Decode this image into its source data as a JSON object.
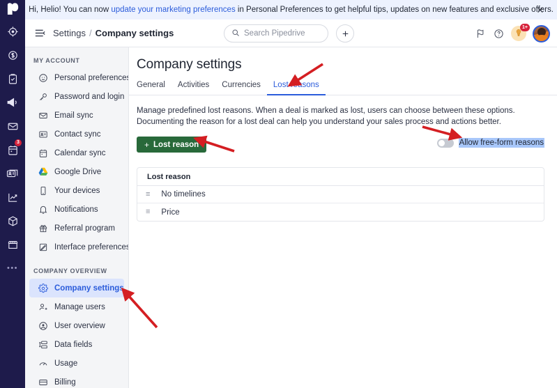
{
  "banner": {
    "text_before": "Hi, Helio! You can now ",
    "link": "update your marketing preferences",
    "text_after": " in Personal Preferences to get helpful tips, updates on new features and exclusive offers.",
    "close_label": "✕"
  },
  "header": {
    "menu_icon": "hamburger-collapse-icon",
    "breadcrumb_root": "Settings",
    "breadcrumb_sep": "/",
    "breadcrumb_current": "Company settings",
    "search_placeholder": "Search Pipedrive",
    "search_value": "",
    "add_label": "+",
    "notification_count": "1+"
  },
  "rail": {
    "items": [
      {
        "name": "target-icon",
        "badge": ""
      },
      {
        "name": "deals-dollar-icon",
        "badge": ""
      },
      {
        "name": "activities-clipboard-icon",
        "badge": ""
      },
      {
        "name": "campaigns-megaphone-icon",
        "badge": ""
      },
      {
        "name": "mail-envelope-icon",
        "badge": ""
      },
      {
        "name": "calendar-icon",
        "badge": "3"
      },
      {
        "name": "contacts-card-icon",
        "badge": ""
      },
      {
        "name": "insights-chart-icon",
        "badge": ""
      },
      {
        "name": "products-box-icon",
        "badge": ""
      },
      {
        "name": "marketplace-shop-icon",
        "badge": ""
      },
      {
        "name": "more-dots-icon",
        "badge": ""
      }
    ]
  },
  "sidebar": {
    "groups": [
      {
        "title": "MY ACCOUNT",
        "items": [
          {
            "label": "Personal preferences",
            "icon": "user-circle-icon",
            "selected": false
          },
          {
            "label": "Password and login",
            "icon": "key-icon",
            "selected": false
          },
          {
            "label": "Email sync",
            "icon": "envelope-icon",
            "selected": false
          },
          {
            "label": "Contact sync",
            "icon": "contact-card-icon",
            "selected": false
          },
          {
            "label": "Calendar sync",
            "icon": "calendar-icon",
            "selected": false
          },
          {
            "label": "Google Drive",
            "icon": "google-drive-icon",
            "selected": false
          },
          {
            "label": "Your devices",
            "icon": "mobile-phone-icon",
            "selected": false
          },
          {
            "label": "Notifications",
            "icon": "bell-icon",
            "selected": false
          },
          {
            "label": "Referral program",
            "icon": "gift-icon",
            "selected": false
          },
          {
            "label": "Interface preferences",
            "icon": "edit-square-icon",
            "selected": false
          }
        ]
      },
      {
        "title": "COMPANY OVERVIEW",
        "items": [
          {
            "label": "Company settings",
            "icon": "gear-icon",
            "selected": true
          },
          {
            "label": "Manage users",
            "icon": "user-add-icon",
            "selected": false
          },
          {
            "label": "User overview",
            "icon": "user-circle-icon",
            "selected": false
          },
          {
            "label": "Data fields",
            "icon": "data-fields-icon",
            "selected": false
          },
          {
            "label": "Usage",
            "icon": "gauge-icon",
            "selected": false
          },
          {
            "label": "Billing",
            "icon": "credit-card-icon",
            "selected": false
          }
        ]
      }
    ]
  },
  "main": {
    "title": "Company settings",
    "tabs": [
      {
        "label": "General",
        "active": false
      },
      {
        "label": "Activities",
        "active": false
      },
      {
        "label": "Currencies",
        "active": false
      },
      {
        "label": "Lost reasons",
        "active": true
      }
    ],
    "description": "Manage predefined lost reasons. When a deal is marked as lost, users can choose between these options. Documenting the reason for a lost deal can help you understand your sales process and actions better.",
    "add_button": {
      "plus": "+",
      "label": "Lost reason"
    },
    "toggle": {
      "label": "Allow free-form reasons",
      "state": "off"
    },
    "table": {
      "column_header": "Lost reason",
      "rows": [
        {
          "drag": "≡",
          "label": "No timelines"
        },
        {
          "drag": "≡",
          "label": "Price"
        }
      ]
    }
  },
  "annotations": {
    "arrow_color": "#d41e22",
    "arrows": [
      {
        "name": "arrow-to-lost-reasons-tab"
      },
      {
        "name": "arrow-to-add-lost-reason-button"
      },
      {
        "name": "arrow-to-free-form-toggle"
      },
      {
        "name": "arrow-to-company-settings-nav"
      }
    ]
  }
}
